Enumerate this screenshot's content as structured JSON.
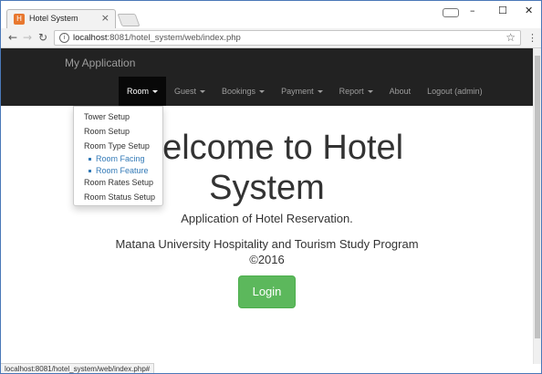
{
  "browser": {
    "tab_title": "Hotel System",
    "tab_favicon_glyph": "H",
    "url_host": "localhost",
    "url_rest": ":8081/hotel_system/web/index.php",
    "status_url": "localhost:8081/hotel_system/web/index.php#"
  },
  "navbar": {
    "brand": "My Application",
    "items": [
      {
        "label": "Room",
        "dropdown": true,
        "active": true
      },
      {
        "label": "Guest",
        "dropdown": true
      },
      {
        "label": "Bookings",
        "dropdown": true
      },
      {
        "label": "Payment",
        "dropdown": true
      },
      {
        "label": "Report",
        "dropdown": true
      },
      {
        "label": "About",
        "dropdown": false
      },
      {
        "label": "Logout (admin)",
        "dropdown": false
      }
    ]
  },
  "room_menu": {
    "tower_setup": "Tower Setup",
    "room_setup": "Room Setup",
    "room_type_setup": "Room Type Setup",
    "room_facing": "Room Facing",
    "room_feature": "Room Feature",
    "room_rates_setup": "Room Rates Setup",
    "room_status_setup": "Room Status Setup"
  },
  "hero": {
    "title_line1": "Welcome to Hotel",
    "title_line2": "System",
    "subtitle": "Application of Hotel Reservation.",
    "program_line1": "Matana University Hospitality and Tourism Study Program",
    "program_line2": "©2016",
    "login_label": "Login"
  },
  "colors": {
    "navbar_bg": "#222222",
    "active_item_bg": "#080808",
    "login_green": "#5cb85c",
    "link_blue": "#337ab7"
  }
}
